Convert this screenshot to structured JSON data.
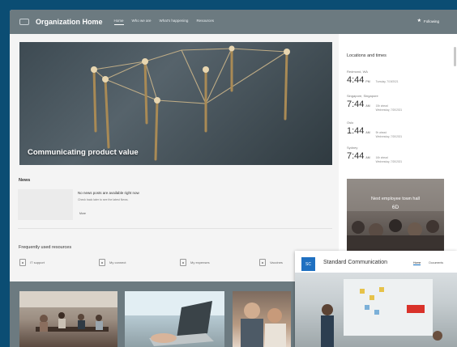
{
  "header": {
    "site_title": "Organization Home",
    "nav": [
      "Home",
      "Who we are",
      "What's happening",
      "Resources"
    ],
    "follow_label": "Following"
  },
  "hero": {
    "caption": "Communicating product value"
  },
  "news": {
    "title": "News",
    "empty_title": "No news posts are available right now",
    "empty_sub": "Check back later to see the latest News.",
    "more": "More"
  },
  "frequent": {
    "title": "Frequently used resources",
    "items": [
      "IT support",
      "My connect",
      "My expenses",
      "Vaccines"
    ]
  },
  "locations": {
    "title": "Locations and times",
    "rows": [
      {
        "city": "Redmond, WA",
        "time": "4:44",
        "ampm": "PM",
        "info1": "Tuesday, 7/19/2021",
        "info2": ""
      },
      {
        "city": "Singapore, Singapore",
        "time": "7:44",
        "ampm": "AM",
        "info1": "15h ahead",
        "info2": "Wednesday, 7/20/2021"
      },
      {
        "city": "Oslo",
        "time": "1:44",
        "ampm": "AM",
        "info1": "9h ahead",
        "info2": "Wednesday, 7/20/2021"
      },
      {
        "city": "Sydney",
        "time": "7:44",
        "ampm": "AM",
        "info1": "16h ahead",
        "info2": "Wednesday, 7/20/2021"
      }
    ]
  },
  "townhall": {
    "title": "Next employee town hall",
    "date": "6D"
  },
  "standard_comm": {
    "logo": "SC",
    "title": "Standard Communication",
    "nav": [
      "Home",
      "Documents"
    ]
  },
  "colors": {
    "background": "#0b4d73",
    "header": "#6c7a80",
    "accent": "#0f6cbd"
  }
}
